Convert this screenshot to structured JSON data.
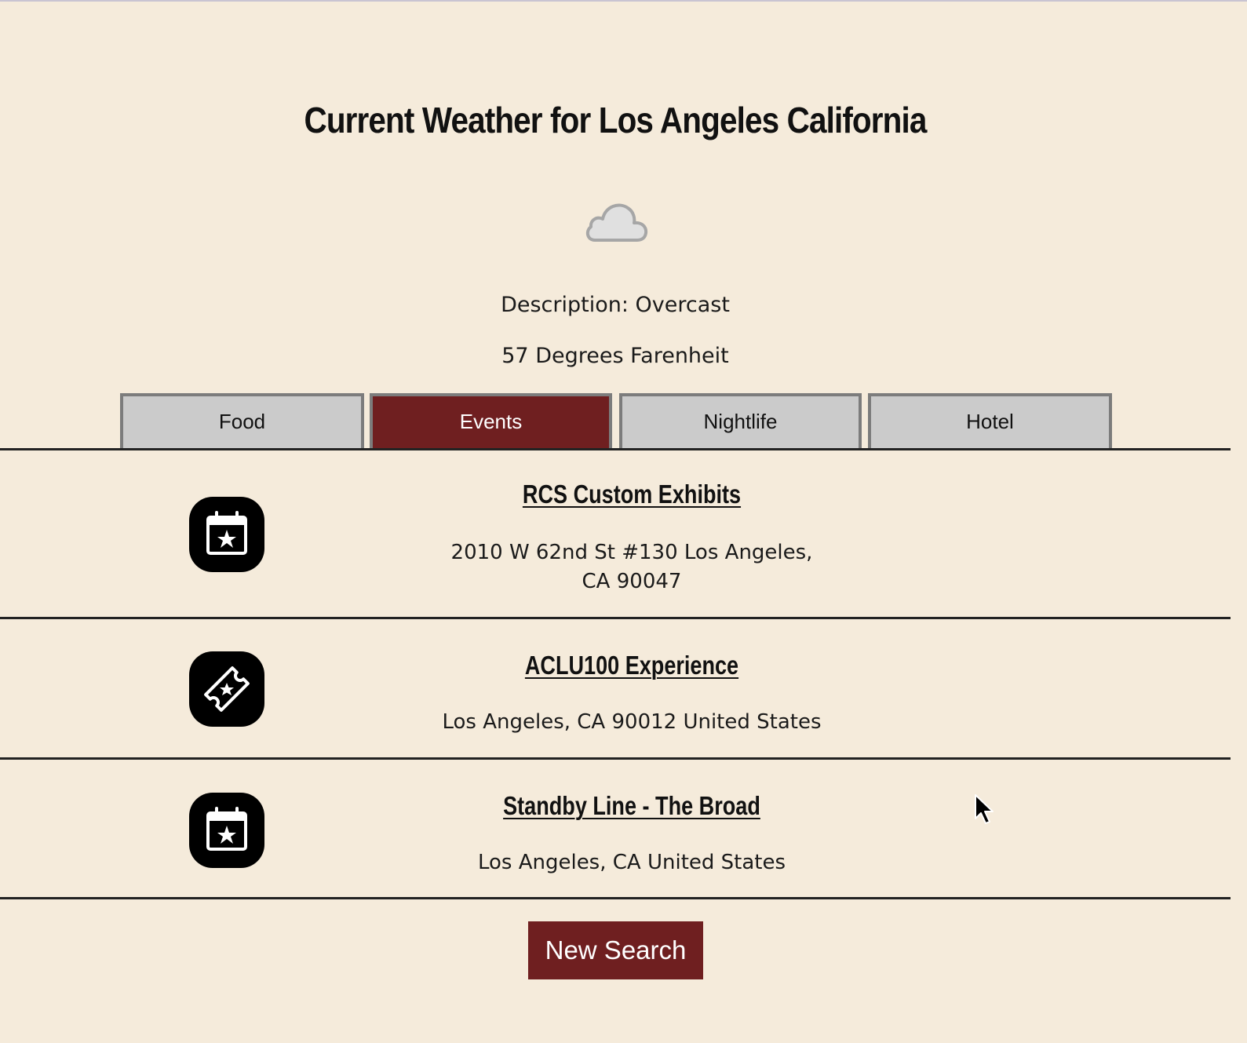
{
  "page": {
    "title": "Current Weather for Los Angeles California"
  },
  "weather": {
    "icon": "cloud-icon",
    "description": "Description: Overcast",
    "temperature": "57 Degrees Farenheit"
  },
  "tabs": [
    {
      "label": "Food",
      "active": false
    },
    {
      "label": "Events",
      "active": true
    },
    {
      "label": "Nightlife",
      "active": false
    },
    {
      "label": "Hotel",
      "active": false
    }
  ],
  "results": [
    {
      "icon": "calendar-star-icon",
      "name": "RCS Custom Exhibits",
      "address": "2010 W 62nd St #130 Los Angeles, CA 90047"
    },
    {
      "icon": "ticket-icon",
      "name": "ACLU100 Experience",
      "address": "Los Angeles, CA 90012 United States"
    },
    {
      "icon": "calendar-star-icon",
      "name": "Standby Line - The Broad",
      "address": "Los Angeles, CA United States"
    }
  ],
  "actions": {
    "new_search_label": "New Search"
  },
  "colors": {
    "background": "#f5ebdb",
    "accent": "#6f1f20",
    "tab_inactive": "#cbcbcb",
    "tab_border": "#7c7c7c"
  }
}
